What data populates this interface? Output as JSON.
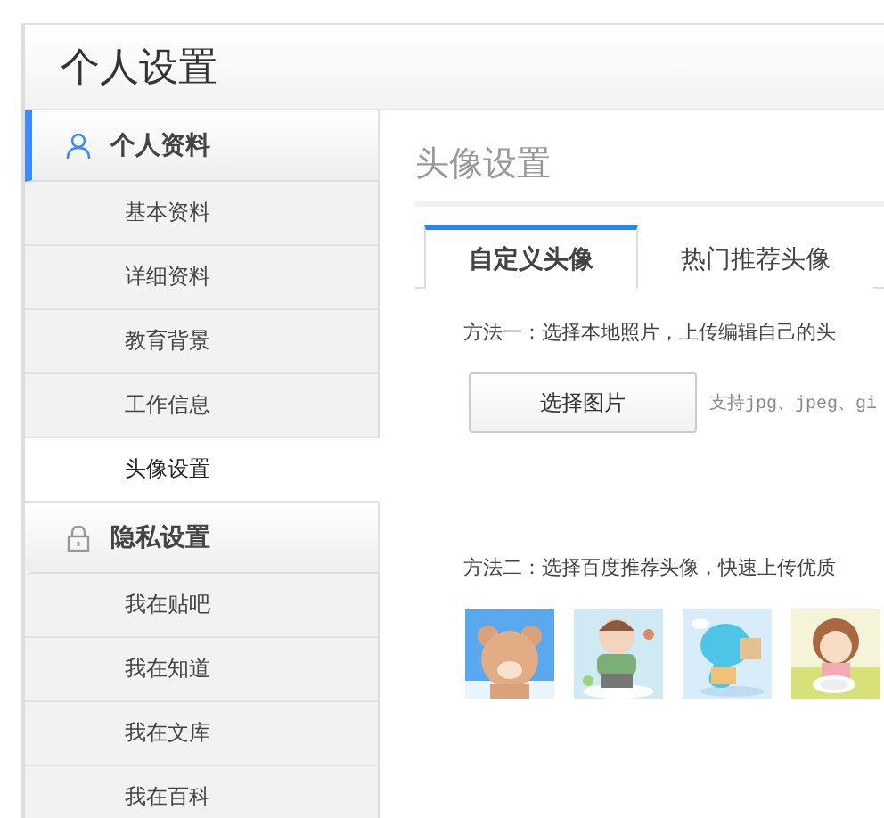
{
  "window": {
    "title": "个人设置"
  },
  "sidebar": {
    "sections": [
      {
        "title": "个人资料",
        "selected": true,
        "items": [
          {
            "label": "基本资料",
            "selected": false
          },
          {
            "label": "详细资料",
            "selected": false
          },
          {
            "label": "教育背景",
            "selected": false
          },
          {
            "label": "工作信息",
            "selected": false
          },
          {
            "label": "头像设置",
            "selected": true
          }
        ]
      },
      {
        "title": "隐私设置",
        "selected": false,
        "items": [
          {
            "label": "我在贴吧",
            "selected": false
          },
          {
            "label": "我在知道",
            "selected": false
          },
          {
            "label": "我在文库",
            "selected": false
          },
          {
            "label": "我在百科",
            "selected": false
          }
        ]
      }
    ]
  },
  "main": {
    "title": "头像设置",
    "tabs": [
      {
        "label": "自定义头像",
        "selected": true
      },
      {
        "label": "热门推荐头像",
        "selected": false
      }
    ],
    "method_one": "方法一：选择本地照片，上传编辑自己的头",
    "choose_button": "选择图片",
    "formats_hint": "支持jpg、jpeg、gi",
    "method_two": "方法二：选择百度推荐头像，快速上传优质"
  }
}
